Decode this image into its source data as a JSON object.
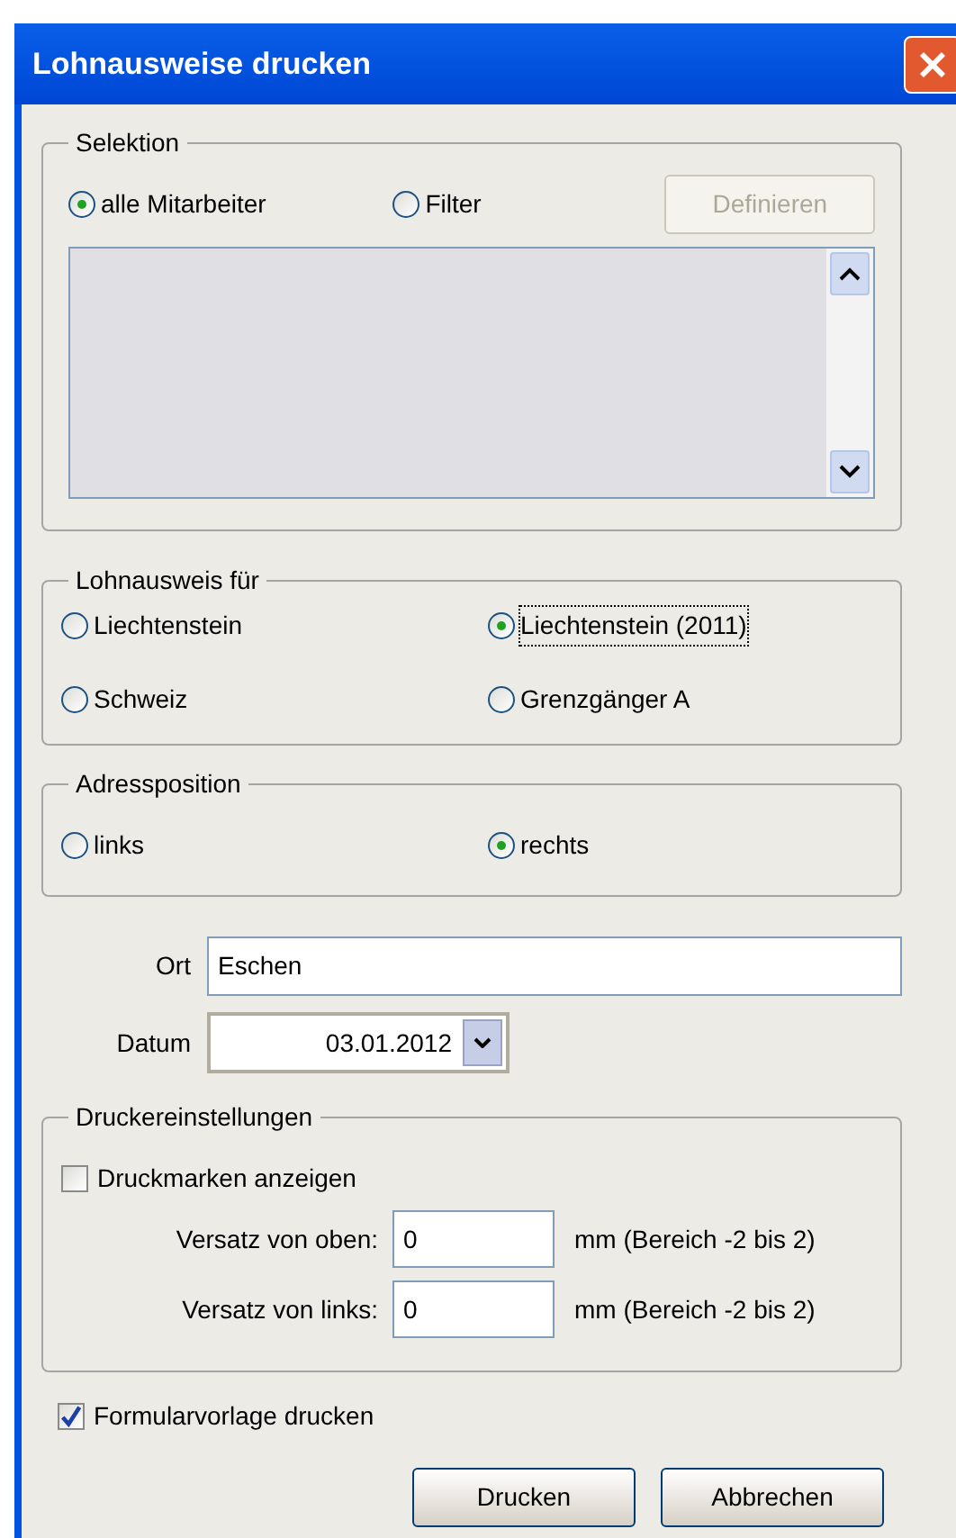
{
  "window": {
    "title": "Lohnausweise drucken"
  },
  "selektion": {
    "title": "Selektion",
    "options": [
      {
        "label": "alle Mitarbeiter",
        "selected": true
      },
      {
        "label": "Filter",
        "selected": false
      }
    ],
    "define_button": {
      "label": "Definieren",
      "disabled": true
    }
  },
  "lohnausweis_fuer": {
    "title": "Lohnausweis für",
    "options": [
      {
        "label": "Liechtenstein",
        "selected": false,
        "focused": false
      },
      {
        "label": "Liechtenstein (2011)",
        "selected": true,
        "focused": true
      },
      {
        "label": "Schweiz",
        "selected": false,
        "focused": false
      },
      {
        "label": "Grenzgänger A",
        "selected": false,
        "focused": false
      }
    ]
  },
  "adressposition": {
    "title": "Adressposition",
    "options": [
      {
        "label": "links",
        "selected": false
      },
      {
        "label": "rechts",
        "selected": true
      }
    ]
  },
  "ort": {
    "label": "Ort",
    "value": "Eschen"
  },
  "datum": {
    "label": "Datum",
    "value": "03.01.2012"
  },
  "druckereinstellungen": {
    "title": "Druckereinstellungen",
    "druckmarken": {
      "label": "Druckmarken anzeigen",
      "checked": false
    },
    "offsets": [
      {
        "label": "Versatz von oben:",
        "value": "0",
        "hint": "mm (Bereich -2 bis 2)"
      },
      {
        "label": "Versatz von links:",
        "value": "0",
        "hint": "mm (Bereich -2 bis 2)"
      }
    ]
  },
  "formularvorlage": {
    "label": "Formularvorlage drucken",
    "checked": true
  },
  "buttons": [
    "Drucken",
    "Abbrechen"
  ]
}
